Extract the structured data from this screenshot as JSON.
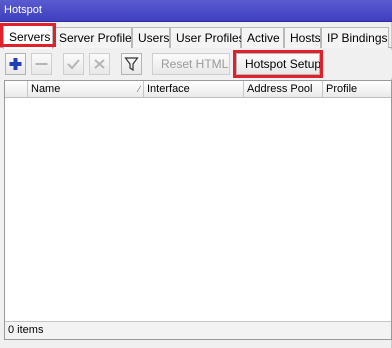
{
  "window": {
    "title": "Hotspot"
  },
  "tabs": [
    {
      "label": "Servers",
      "active": true
    },
    {
      "label": "Server Profiles"
    },
    {
      "label": "Users"
    },
    {
      "label": "User Profiles"
    },
    {
      "label": "Active"
    },
    {
      "label": "Hosts"
    },
    {
      "label": "IP Bindings"
    }
  ],
  "toolbar": {
    "add_icon": "plus-icon",
    "remove_icon": "minus-icon",
    "enable_icon": "check-icon",
    "disable_icon": "x-icon",
    "filter_icon": "filter-icon",
    "reset_html_label": "Reset HTML",
    "hotspot_setup_label": "Hotspot Setup"
  },
  "table": {
    "columns": [
      "Name",
      "Interface",
      "Address Pool",
      "Profile"
    ],
    "rows": []
  },
  "status": {
    "items_text": "0 items"
  },
  "colors": {
    "titlebar": "#4343c4",
    "highlight": "#e0202a",
    "add_blue": "#1f3fb6"
  }
}
